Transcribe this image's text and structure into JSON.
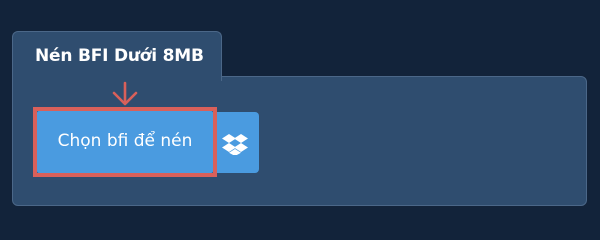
{
  "tab": {
    "title": "Nén BFI Dưới 8MB"
  },
  "upload": {
    "choose_label": "Chọn bfi để nén",
    "dropbox_icon": "dropbox-icon"
  },
  "annotation": {
    "arrow_icon": "arrow-down-icon",
    "highlight_color": "#d9605a"
  },
  "colors": {
    "background": "#12233a",
    "panel": "#2f4d6f",
    "button": "#4a9be0",
    "highlight": "#d9605a"
  }
}
